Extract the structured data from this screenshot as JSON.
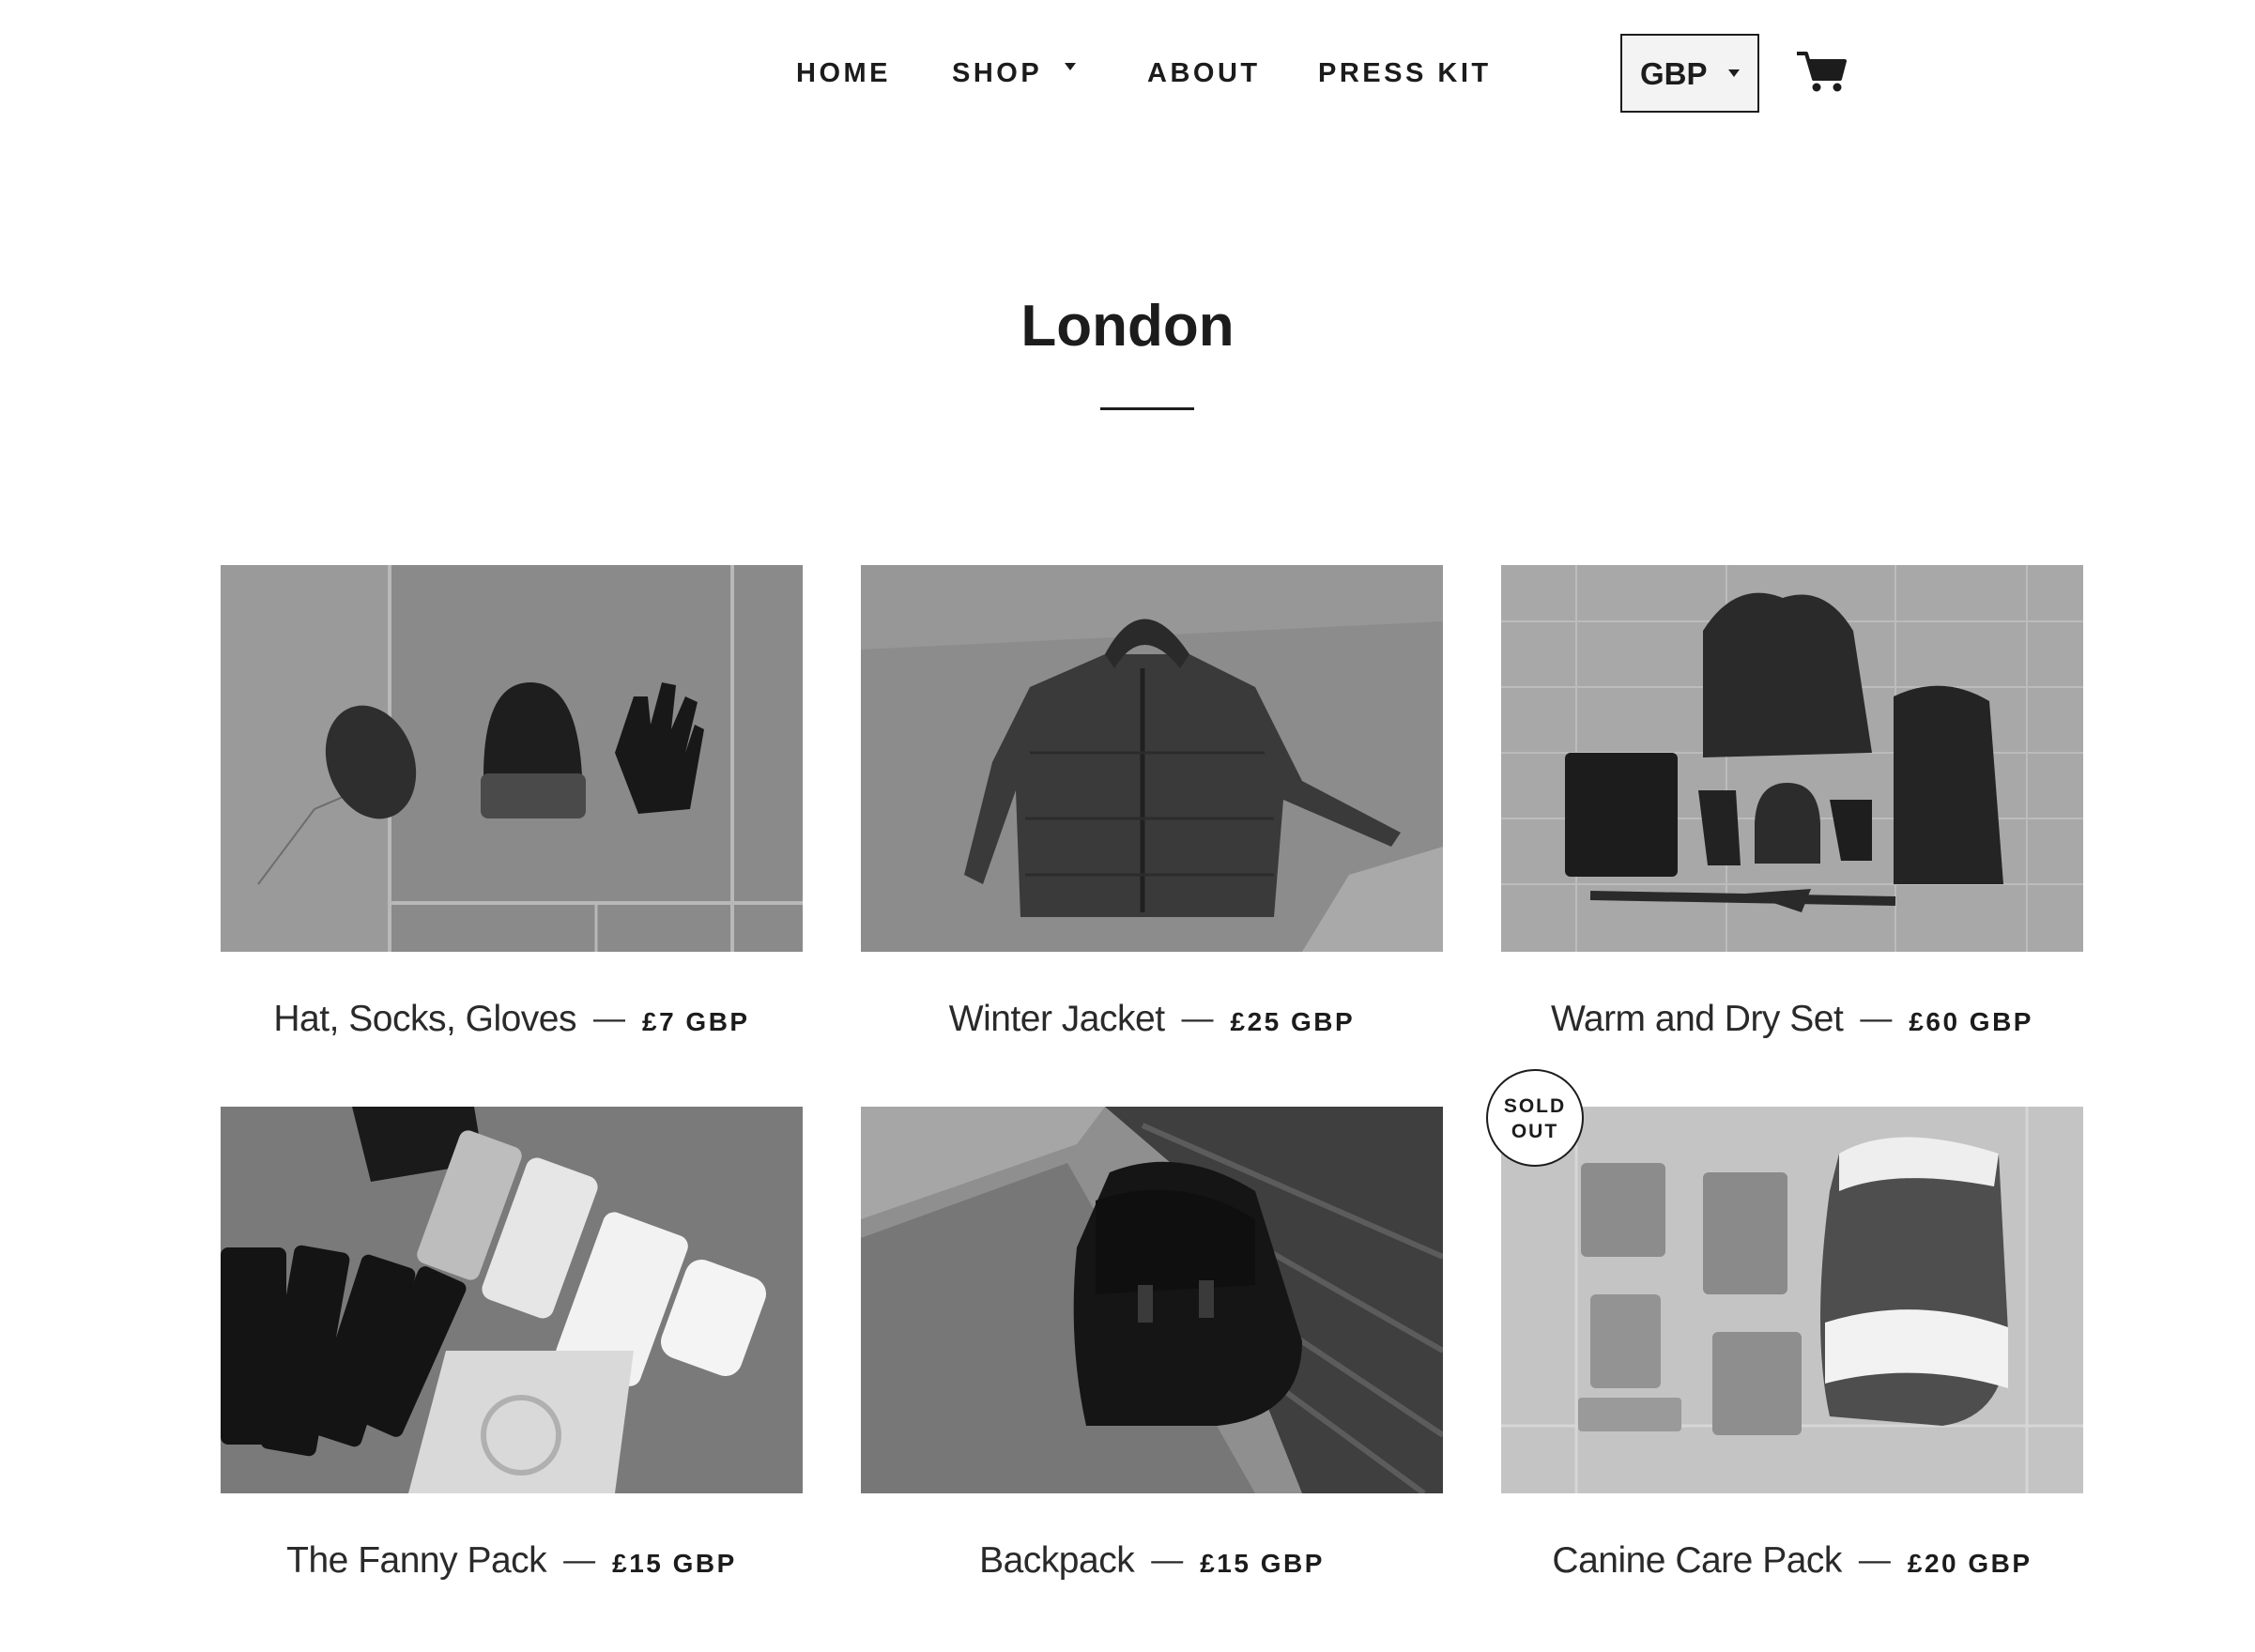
{
  "nav": {
    "home": "HOME",
    "shop": "SHOP",
    "about": "ABOUT",
    "press_kit": "PRESS KIT",
    "currency": "GBP",
    "cart_icon": "cart-icon"
  },
  "page": {
    "title": "London"
  },
  "products": [
    {
      "name": "Hat, Socks, Gloves",
      "separator": "—",
      "price": "£7 GBP",
      "sold_out": false
    },
    {
      "name": "Winter Jacket",
      "separator": "—",
      "price": "£25 GBP",
      "sold_out": false
    },
    {
      "name": "Warm and Dry Set",
      "separator": "—",
      "price": "£60 GBP",
      "sold_out": false
    },
    {
      "name": "The Fanny Pack",
      "separator": "—",
      "price": "£15 GBP",
      "sold_out": false
    },
    {
      "name": "Backpack",
      "separator": "—",
      "price": "£15 GBP",
      "sold_out": false
    },
    {
      "name": "Canine Care Pack",
      "separator": "—",
      "price": "£20 GBP",
      "sold_out": true,
      "badge_line1": "SOLD",
      "badge_line2": "OUT"
    }
  ],
  "colors": {
    "text": "#1c1c1c",
    "background": "#ffffff",
    "currency_bg": "#f3f3f3"
  }
}
